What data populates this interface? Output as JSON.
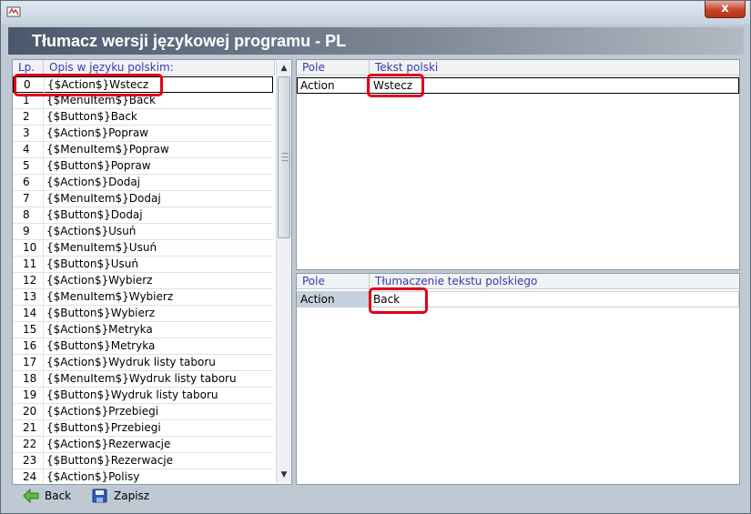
{
  "window": {
    "title": "",
    "close_label": "x"
  },
  "header": {
    "title": "Tłumacz wersji językowej programu - PL"
  },
  "left_list": {
    "columns": [
      "Lp.",
      "Opis w języku polskim:"
    ],
    "rows": [
      {
        "num": "0",
        "text": "{$Action$}Wstecz"
      },
      {
        "num": "1",
        "text": "{$MenuItem$}Back"
      },
      {
        "num": "2",
        "text": "{$Button$}Back"
      },
      {
        "num": "3",
        "text": "{$Action$}Popraw"
      },
      {
        "num": "4",
        "text": "{$MenuItem$}Popraw"
      },
      {
        "num": "5",
        "text": "{$Button$}Popraw"
      },
      {
        "num": "6",
        "text": "{$Action$}Dodaj"
      },
      {
        "num": "7",
        "text": "{$MenuItem$}Dodaj"
      },
      {
        "num": "8",
        "text": "{$Button$}Dodaj"
      },
      {
        "num": "9",
        "text": "{$Action$}Usuń"
      },
      {
        "num": "10",
        "text": "{$MenuItem$}Usuń"
      },
      {
        "num": "11",
        "text": "{$Button$}Usuń"
      },
      {
        "num": "12",
        "text": "{$Action$}Wybierz"
      },
      {
        "num": "13",
        "text": "{$MenuItem$}Wybierz"
      },
      {
        "num": "14",
        "text": "{$Button$}Wybierz"
      },
      {
        "num": "15",
        "text": "{$Action$}Metryka"
      },
      {
        "num": "16",
        "text": "{$Button$}Metryka"
      },
      {
        "num": "17",
        "text": "{$Action$}Wydruk listy taboru"
      },
      {
        "num": "18",
        "text": "{$MenuItem$}Wydruk listy taboru"
      },
      {
        "num": "19",
        "text": "{$Button$}Wydruk listy taboru"
      },
      {
        "num": "20",
        "text": "{$Action$}Przebiegi"
      },
      {
        "num": "21",
        "text": "{$Button$}Przebiegi"
      },
      {
        "num": "22",
        "text": "{$Action$}Rezerwacje"
      },
      {
        "num": "23",
        "text": "{$Button$}Rezerwacje"
      },
      {
        "num": "24",
        "text": "{$Action$}Polisy"
      }
    ],
    "selected_index": 0
  },
  "polish_panel": {
    "columns": [
      "Pole",
      "Tekst polski"
    ],
    "row": {
      "pole": "Action",
      "value": "Wstecz"
    }
  },
  "translation_panel": {
    "columns": [
      "Pole",
      "Tłumaczenie tekstu polskiego"
    ],
    "row": {
      "pole": "Action",
      "value": "Back"
    }
  },
  "footer": {
    "back_label": "Back",
    "save_label": "Zapisz"
  },
  "colors": {
    "highlight": "#e0001a",
    "header_text": "#3a3aa8"
  }
}
